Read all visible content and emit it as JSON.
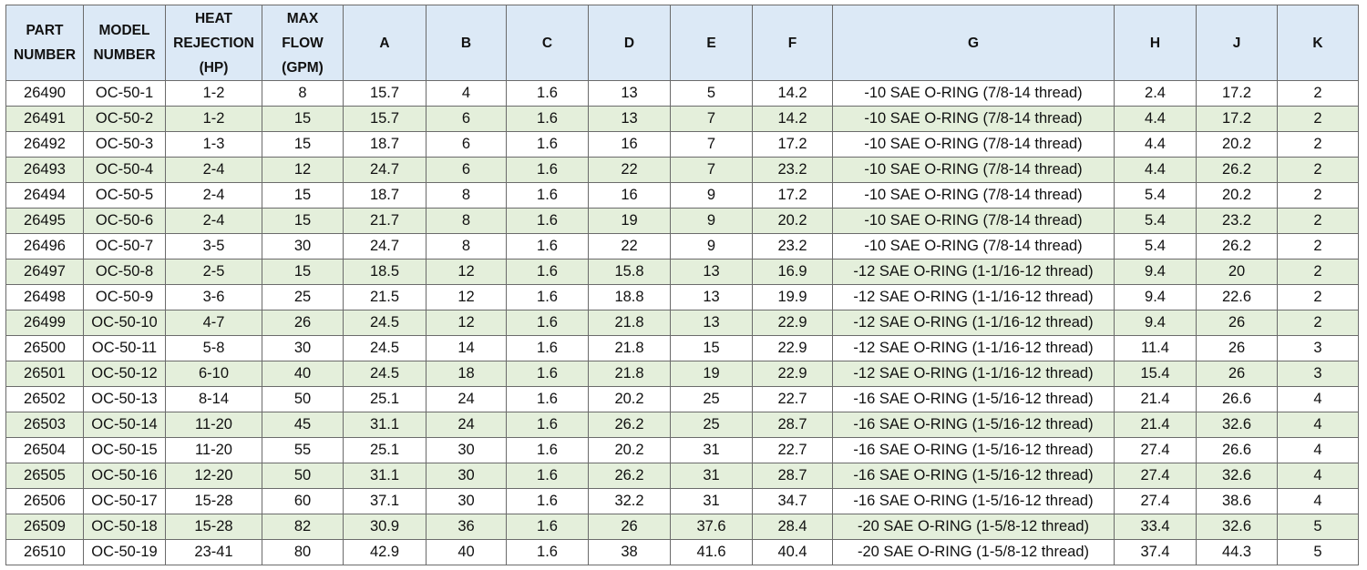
{
  "table": {
    "headers": [
      [
        "PART",
        "NUMBER"
      ],
      [
        "MODEL",
        "NUMBER"
      ],
      [
        "HEAT",
        "REJECTION",
        "(HP)"
      ],
      [
        "MAX",
        "FLOW",
        "(GPM)"
      ],
      [
        "A"
      ],
      [
        "B"
      ],
      [
        "C"
      ],
      [
        "D"
      ],
      [
        "E"
      ],
      [
        "F"
      ],
      [
        "G"
      ],
      [
        "H"
      ],
      [
        "J"
      ],
      [
        "K"
      ]
    ],
    "rows": [
      [
        "26490",
        "OC-50-1",
        "1-2",
        "8",
        "15.7",
        "4",
        "1.6",
        "13",
        "5",
        "14.2",
        "-10 SAE O-RING (7/8-14 thread)",
        "2.4",
        "17.2",
        "2"
      ],
      [
        "26491",
        "OC-50-2",
        "1-2",
        "15",
        "15.7",
        "6",
        "1.6",
        "13",
        "7",
        "14.2",
        "-10 SAE O-RING (7/8-14 thread)",
        "4.4",
        "17.2",
        "2"
      ],
      [
        "26492",
        "OC-50-3",
        "1-3",
        "15",
        "18.7",
        "6",
        "1.6",
        "16",
        "7",
        "17.2",
        "-10 SAE O-RING (7/8-14 thread)",
        "4.4",
        "20.2",
        "2"
      ],
      [
        "26493",
        "OC-50-4",
        "2-4",
        "12",
        "24.7",
        "6",
        "1.6",
        "22",
        "7",
        "23.2",
        "-10 SAE O-RING (7/8-14 thread)",
        "4.4",
        "26.2",
        "2"
      ],
      [
        "26494",
        "OC-50-5",
        "2-4",
        "15",
        "18.7",
        "8",
        "1.6",
        "16",
        "9",
        "17.2",
        "-10 SAE O-RING (7/8-14 thread)",
        "5.4",
        "20.2",
        "2"
      ],
      [
        "26495",
        "OC-50-6",
        "2-4",
        "15",
        "21.7",
        "8",
        "1.6",
        "19",
        "9",
        "20.2",
        "-10 SAE O-RING (7/8-14 thread)",
        "5.4",
        "23.2",
        "2"
      ],
      [
        "26496",
        "OC-50-7",
        "3-5",
        "30",
        "24.7",
        "8",
        "1.6",
        "22",
        "9",
        "23.2",
        "-10 SAE O-RING (7/8-14 thread)",
        "5.4",
        "26.2",
        "2"
      ],
      [
        "26497",
        "OC-50-8",
        "2-5",
        "15",
        "18.5",
        "12",
        "1.6",
        "15.8",
        "13",
        "16.9",
        "-12 SAE O-RING (1-1/16-12 thread)",
        "9.4",
        "20",
        "2"
      ],
      [
        "26498",
        "OC-50-9",
        "3-6",
        "25",
        "21.5",
        "12",
        "1.6",
        "18.8",
        "13",
        "19.9",
        "-12 SAE O-RING (1-1/16-12 thread)",
        "9.4",
        "22.6",
        "2"
      ],
      [
        "26499",
        "OC-50-10",
        "4-7",
        "26",
        "24.5",
        "12",
        "1.6",
        "21.8",
        "13",
        "22.9",
        "-12 SAE O-RING (1-1/16-12 thread)",
        "9.4",
        "26",
        "2"
      ],
      [
        "26500",
        "OC-50-11",
        "5-8",
        "30",
        "24.5",
        "14",
        "1.6",
        "21.8",
        "15",
        "22.9",
        "-12 SAE O-RING (1-1/16-12 thread)",
        "11.4",
        "26",
        "3"
      ],
      [
        "26501",
        "OC-50-12",
        "6-10",
        "40",
        "24.5",
        "18",
        "1.6",
        "21.8",
        "19",
        "22.9",
        "-12 SAE O-RING (1-1/16-12 thread)",
        "15.4",
        "26",
        "3"
      ],
      [
        "26502",
        "OC-50-13",
        "8-14",
        "50",
        "25.1",
        "24",
        "1.6",
        "20.2",
        "25",
        "22.7",
        "-16 SAE O-RING (1-5/16-12 thread)",
        "21.4",
        "26.6",
        "4"
      ],
      [
        "26503",
        "OC-50-14",
        "11-20",
        "45",
        "31.1",
        "24",
        "1.6",
        "26.2",
        "25",
        "28.7",
        "-16 SAE O-RING (1-5/16-12 thread)",
        "21.4",
        "32.6",
        "4"
      ],
      [
        "26504",
        "OC-50-15",
        "11-20",
        "55",
        "25.1",
        "30",
        "1.6",
        "20.2",
        "31",
        "22.7",
        "-16 SAE O-RING (1-5/16-12 thread)",
        "27.4",
        "26.6",
        "4"
      ],
      [
        "26505",
        "OC-50-16",
        "12-20",
        "50",
        "31.1",
        "30",
        "1.6",
        "26.2",
        "31",
        "28.7",
        "-16 SAE O-RING (1-5/16-12 thread)",
        "27.4",
        "32.6",
        "4"
      ],
      [
        "26506",
        "OC-50-17",
        "15-28",
        "60",
        "37.1",
        "30",
        "1.6",
        "32.2",
        "31",
        "34.7",
        "-16 SAE O-RING (1-5/16-12 thread)",
        "27.4",
        "38.6",
        "4"
      ],
      [
        "26509",
        "OC-50-18",
        "15-28",
        "82",
        "30.9",
        "36",
        "1.6",
        "26",
        "37.6",
        "28.4",
        "-20 SAE O-RING (1-5/8-12 thread)",
        "33.4",
        "32.6",
        "5"
      ],
      [
        "26510",
        "OC-50-19",
        "23-41",
        "80",
        "42.9",
        "40",
        "1.6",
        "38",
        "41.6",
        "40.4",
        "-20 SAE O-RING (1-5/8-12 thread)",
        "37.4",
        "44.3",
        "5"
      ]
    ]
  },
  "colors": {
    "header_bg": "#dce9f6",
    "alt_row_bg": "#e4efdb",
    "row_bg": "#ffffff",
    "border": "#6b6b6b"
  }
}
